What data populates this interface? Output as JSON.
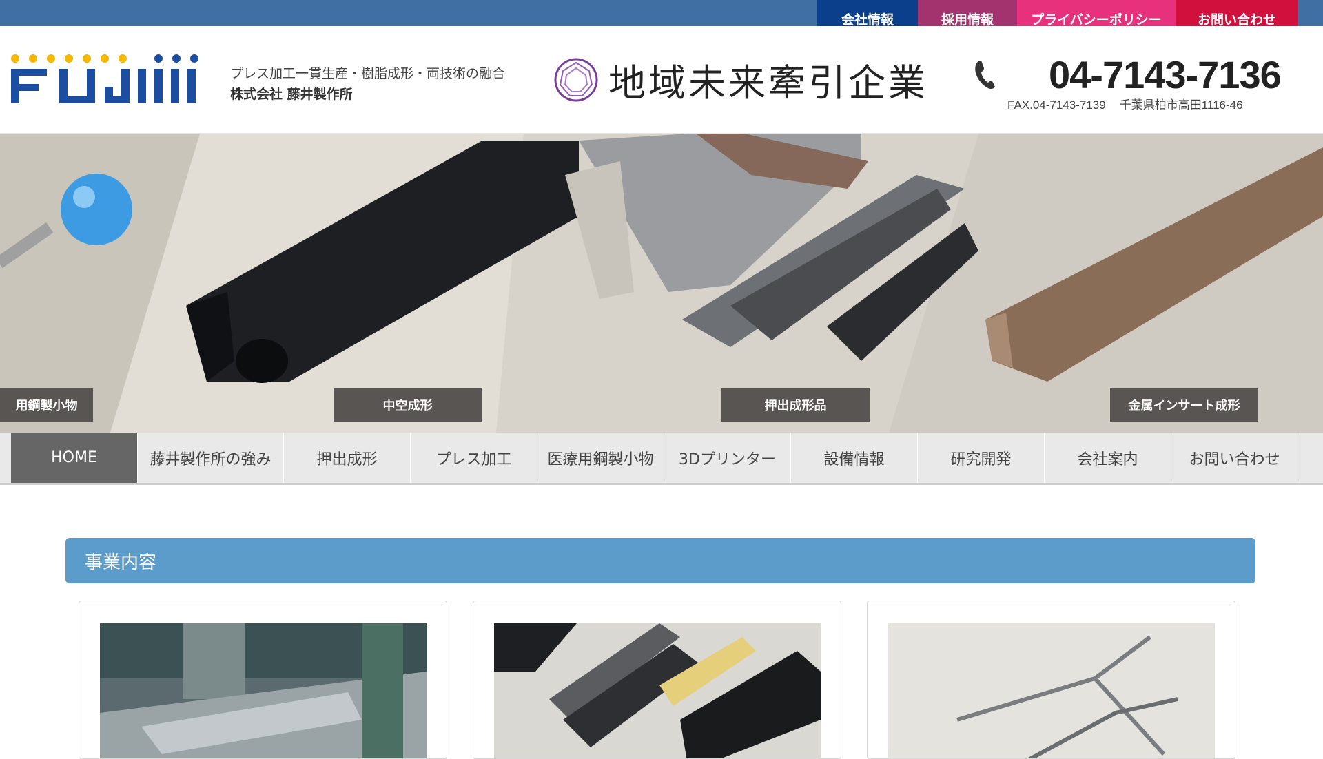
{
  "top_links": [
    {
      "label": "会社情報"
    },
    {
      "label": "採用情報"
    },
    {
      "label": "プライバシーポリシー"
    },
    {
      "label": "お問い合わせ"
    }
  ],
  "header": {
    "tagline": "プレス加工一貫生産・樹脂成形・両技術の融合",
    "company": "株式会社 藤井製作所",
    "badge": "地域未来牽引企業",
    "phone": "04-7143-7136",
    "fax": "FAX.04-7143-7139",
    "address": "千葉県柏市高田1116-46"
  },
  "hero": {
    "labels": [
      "用鋼製小物",
      "中空成形",
      "押出成形品",
      "金属インサート成形"
    ]
  },
  "nav": [
    {
      "label": "HOME",
      "active": true
    },
    {
      "label": "藤井製作所の強み"
    },
    {
      "label": "押出成形"
    },
    {
      "label": "プレス加工"
    },
    {
      "label": "医療用鋼製小物"
    },
    {
      "label": "3Dプリンター"
    },
    {
      "label": "設備情報"
    },
    {
      "label": "研究開発"
    },
    {
      "label": "会社案内"
    },
    {
      "label": "お問い合わせ"
    }
  ],
  "section": {
    "title": "事業内容"
  },
  "colors": {
    "topbar": "#3f6fa3",
    "section": "#5b9ccb",
    "nav_active": "#666666",
    "logo_blue": "#1b4ea0",
    "logo_yellow": "#f5b800"
  },
  "icons": {
    "phone": "phone-icon",
    "badge": "diamond-ring-icon"
  }
}
